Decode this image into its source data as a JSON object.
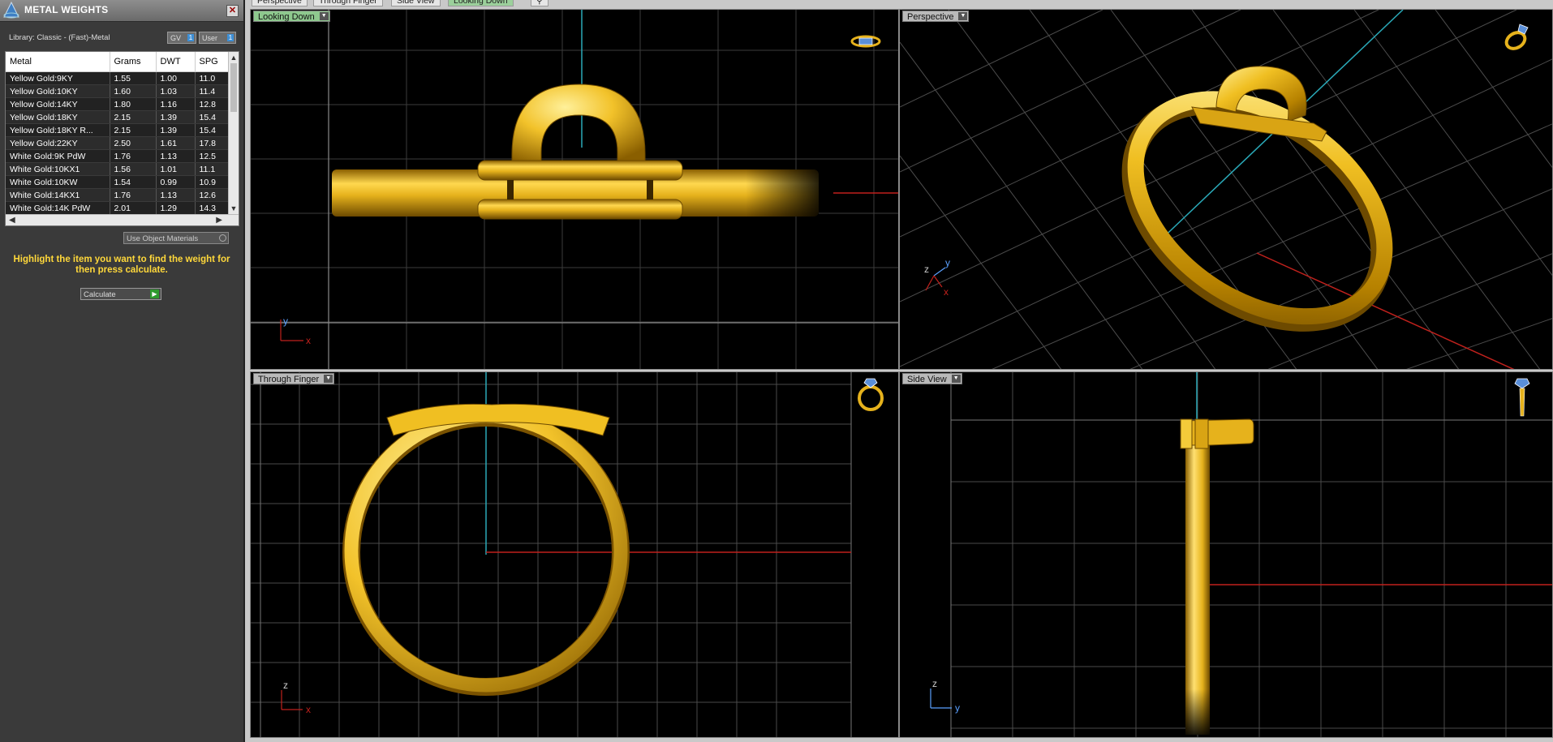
{
  "panel": {
    "title": "METAL WEIGHTS",
    "close_glyph": "✕",
    "library_label": "Library: Classic - (Fast)-Metal",
    "toggle_gv": "GV",
    "toggle_user": "User",
    "toggle_indicator": "1",
    "table": {
      "headers": [
        "Metal",
        "Grams",
        "DWT",
        "SPG"
      ],
      "rows": [
        [
          "Yellow Gold:9KY",
          "1.55",
          "1.00",
          "11.0"
        ],
        [
          "Yellow Gold:10KY",
          "1.60",
          "1.03",
          "11.4"
        ],
        [
          "Yellow Gold:14KY",
          "1.80",
          "1.16",
          "12.8"
        ],
        [
          "Yellow Gold:18KY",
          "2.15",
          "1.39",
          "15.4"
        ],
        [
          "Yellow Gold:18KY R...",
          "2.15",
          "1.39",
          "15.4"
        ],
        [
          "Yellow Gold:22KY",
          "2.50",
          "1.61",
          "17.8"
        ],
        [
          "White Gold:9K PdW",
          "1.76",
          "1.13",
          "12.5"
        ],
        [
          "White Gold:10KX1",
          "1.56",
          "1.01",
          "11.1"
        ],
        [
          "White Gold:10KW",
          "1.54",
          "0.99",
          "10.9"
        ],
        [
          "White Gold:14KX1",
          "1.76",
          "1.13",
          "12.6"
        ],
        [
          "White Gold:14K PdW",
          "2.01",
          "1.29",
          "14.3"
        ]
      ]
    },
    "use_object_materials": "Use Object Materials",
    "instructions": "Highlight the item you want to find the weight for then press calculate.",
    "calculate_label": "Calculate"
  },
  "tabs": [
    {
      "label": "Perspective",
      "active": false
    },
    {
      "label": "Through Finger",
      "active": false
    },
    {
      "label": "Side View",
      "active": false
    },
    {
      "label": "Looking Down",
      "active": true
    }
  ],
  "viewports": {
    "top_left": {
      "label": "Looking Down",
      "active": true,
      "axis_a": "y",
      "axis_b": "x"
    },
    "top_right": {
      "label": "Perspective",
      "active": false,
      "axis_a": "z",
      "axis_b": "y",
      "axis_c": "x"
    },
    "bottom_left": {
      "label": "Through Finger",
      "active": false,
      "axis_a": "z",
      "axis_b": "x"
    },
    "bottom_right": {
      "label": "Side View",
      "active": false,
      "axis_a": "z",
      "axis_b": "y"
    }
  },
  "colors": {
    "gold": "#e6b21c",
    "gold_light": "#ffe071",
    "gold_dark": "#8a5f00",
    "grid": "#5a5a5a",
    "axis_red": "#c0211c",
    "axis_cyan": "#2aa9b8"
  }
}
